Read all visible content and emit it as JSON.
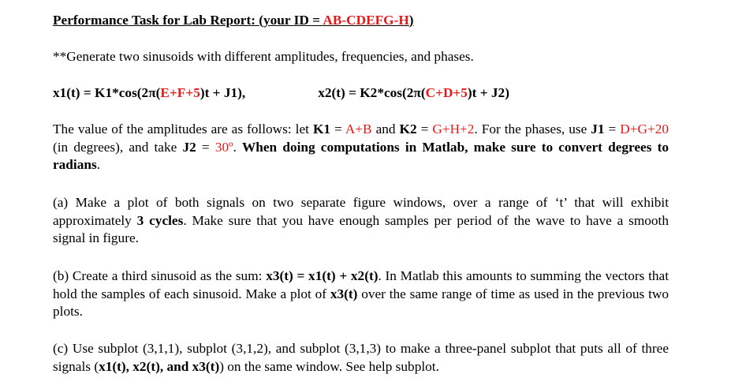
{
  "title": {
    "prefix": "Performance Task for Lab Report: (your ID = ",
    "id": "AB-CDEFG-H",
    "suffix": ")"
  },
  "intro": "**Generate two sinusoids with different amplitudes, frequencies, and phases.",
  "equations": {
    "x1_pre": "x1(t) = K1*cos(2π(",
    "x1_var": "E+F+5",
    "x1_post": ")t + J1),",
    "x2_pre": "x2(t) = K2*cos(2π(",
    "x2_var": "C+D+5",
    "x2_post": ")t + J2)"
  },
  "values": {
    "t1": "The value of the amplitudes are as follows: let ",
    "k1": "K1",
    "t2": " = ",
    "k1_val": "A+B",
    "t3": " and ",
    "k2": "K2",
    "t4": " = ",
    "k2_val": "G+H+2",
    "t5": ". For the phases, use ",
    "j1": "J1",
    "t6": " = ",
    "j1_val": "D+G+20",
    "t7": " (in degrees), and take ",
    "j2": "J2",
    "t8": " = ",
    "j2_val": "30º",
    "t9": ". ",
    "bold_note": "When doing computations in Matlab, make sure to convert degrees to radians",
    "t10": "."
  },
  "part_a": {
    "t1": "(a) Make a plot of both signals on two separate figure windows, over a range of ‘t’ that will exhibit approximately ",
    "b1": "3 cycles",
    "t2": ". Make sure that you have enough samples per period of the wave to have a smooth signal in figure."
  },
  "part_b": {
    "t1": "(b) Create a third sinusoid as the sum: ",
    "b1": "x3(t) = x1(t) + x2(t)",
    "t2": ". In Matlab this amounts to summing the vectors that hold the samples of each sinusoid. Make a plot of ",
    "b2": "x3(t)",
    "t3": " over the same range of time as used in the previous two plots."
  },
  "part_c": {
    "t1": "(c) Use subplot (3,1,1), subplot (3,1,2), and subplot (3,1,3) to make a three-panel subplot that puts all of three signals (",
    "b1": "x1(t), x2(t), and x3(t)",
    "t2": ") on the same window. See help subplot."
  }
}
